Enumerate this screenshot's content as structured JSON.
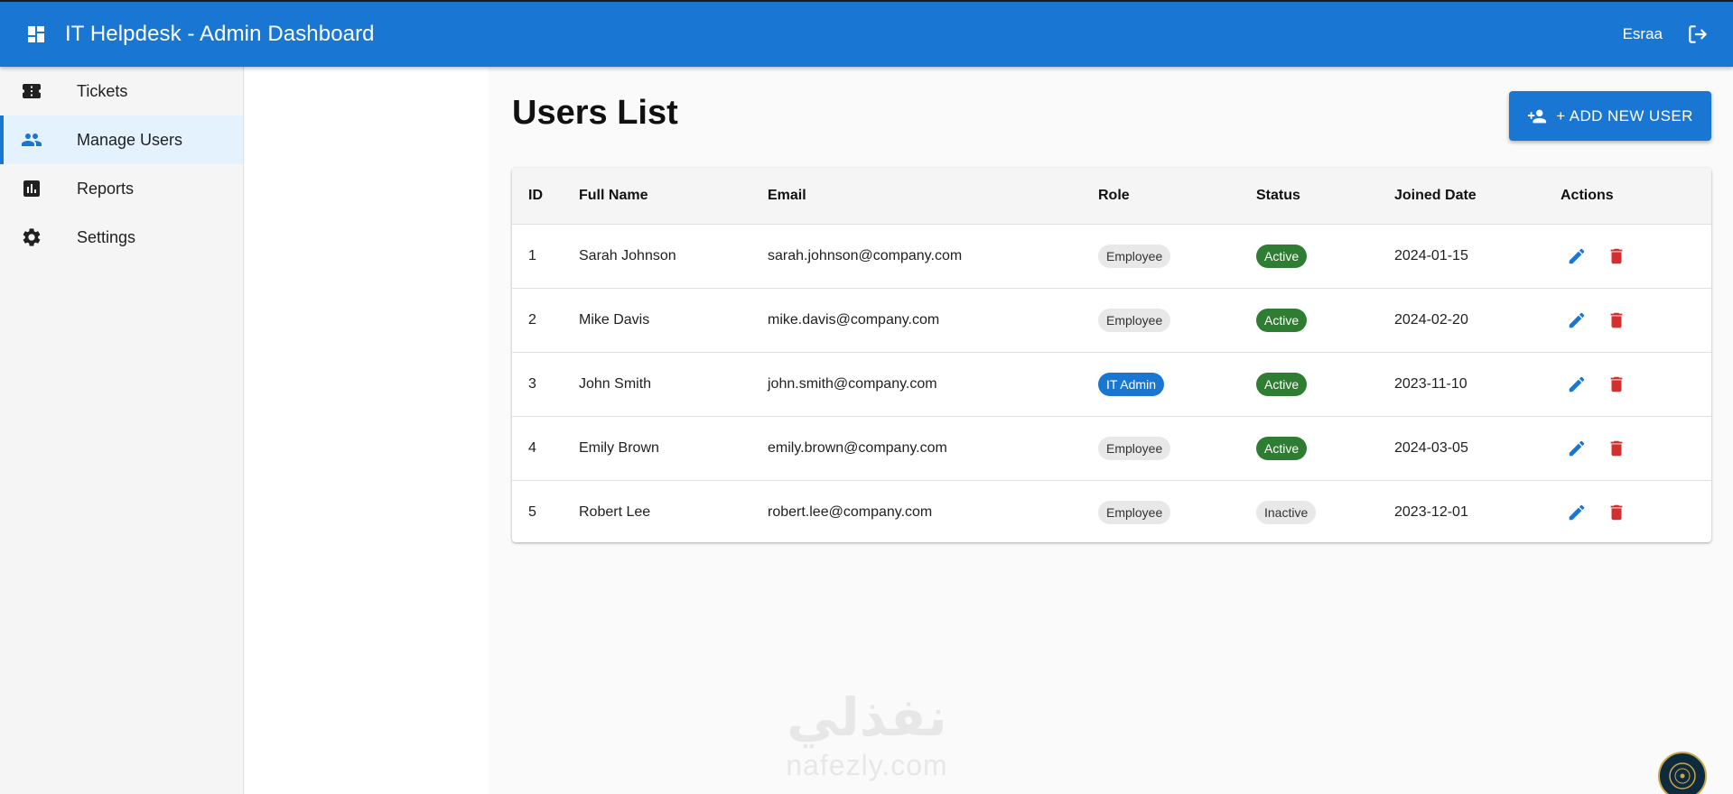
{
  "header": {
    "title": "IT Helpdesk - Admin Dashboard",
    "username": "Esraa"
  },
  "sidebar": {
    "items": [
      {
        "label": "Tickets",
        "icon": "ticket-icon",
        "active": false
      },
      {
        "label": "Manage Users",
        "icon": "people-icon",
        "active": true
      },
      {
        "label": "Reports",
        "icon": "bar-chart-icon",
        "active": false
      },
      {
        "label": "Settings",
        "icon": "gear-icon",
        "active": false
      }
    ]
  },
  "main": {
    "title": "Users List",
    "add_button_label": "+ ADD NEW USER",
    "table": {
      "headers": [
        "ID",
        "Full Name",
        "Email",
        "Role",
        "Status",
        "Joined Date",
        "Actions"
      ],
      "rows": [
        {
          "id": "1",
          "name": "Sarah Johnson",
          "email": "sarah.johnson@company.com",
          "role": "Employee",
          "status": "Active",
          "joined": "2024-01-15"
        },
        {
          "id": "2",
          "name": "Mike Davis",
          "email": "mike.davis@company.com",
          "role": "Employee",
          "status": "Active",
          "joined": "2024-02-20"
        },
        {
          "id": "3",
          "name": "John Smith",
          "email": "john.smith@company.com",
          "role": "IT Admin",
          "status": "Active",
          "joined": "2023-11-10"
        },
        {
          "id": "4",
          "name": "Emily Brown",
          "email": "emily.brown@company.com",
          "role": "Employee",
          "status": "Active",
          "joined": "2024-03-05"
        },
        {
          "id": "5",
          "name": "Robert Lee",
          "email": "robert.lee@company.com",
          "role": "Employee",
          "status": "Inactive",
          "joined": "2023-12-01"
        }
      ]
    }
  },
  "watermark": {
    "arabic": "نفذلي",
    "latin": "nafezly.com"
  },
  "colors": {
    "primary": "#1976d2",
    "active": "#2e7d32",
    "delete": "#d32f2f",
    "chip_grey": "#e8e8e8"
  }
}
